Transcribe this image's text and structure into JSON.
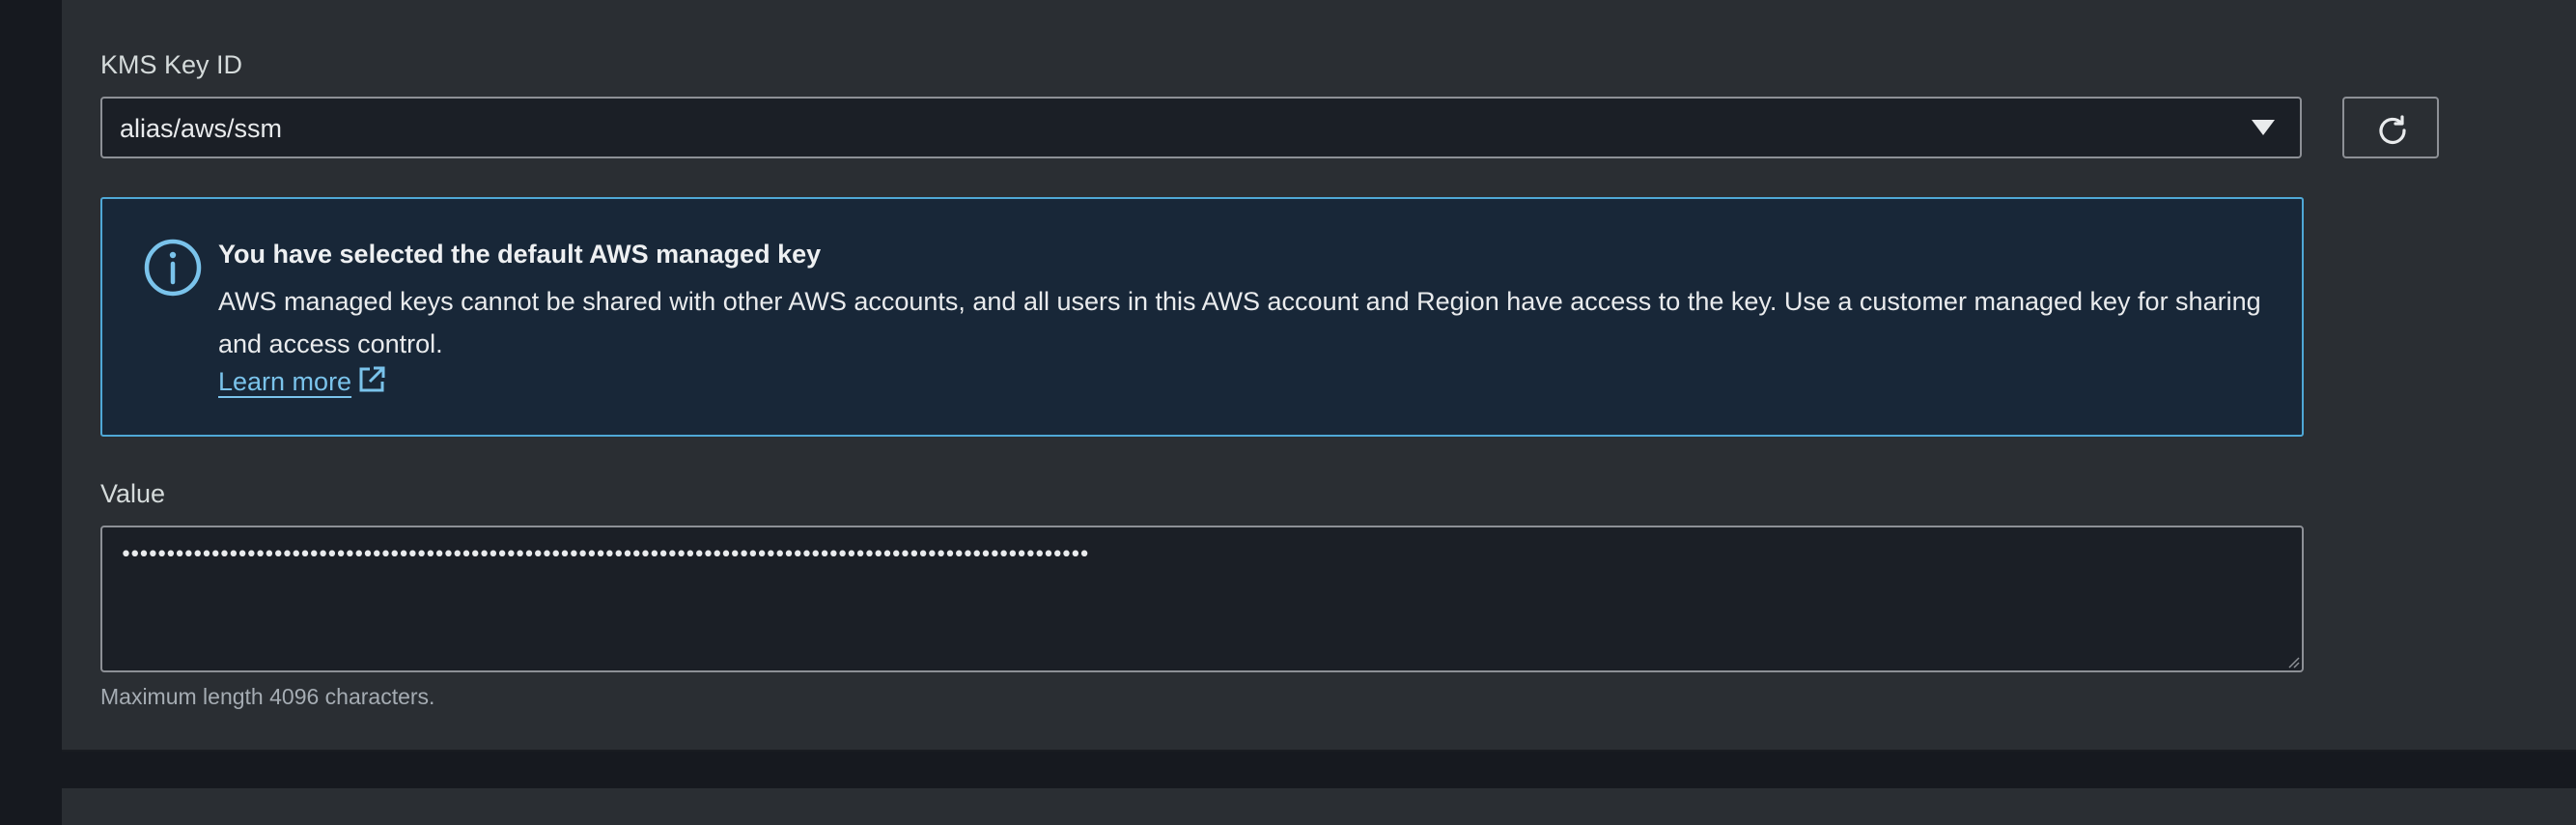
{
  "kms": {
    "label": "KMS Key ID",
    "selected_value": "alias/aws/ssm",
    "refresh_icon": "refresh-icon"
  },
  "info": {
    "icon": "info-icon",
    "title": "You have selected the default AWS managed key",
    "body": "AWS managed keys cannot be shared with other AWS accounts, and all users in this AWS account and Region have access to the key. Use a customer managed key for sharing and access control.",
    "link_label": "Learn more",
    "link_icon": "external-link-icon"
  },
  "value_field": {
    "label": "Value",
    "masked_value": "••••••••••••••••••••••••••••••••••••••••••••••••••••••••••••••••••••••••••••••••••••••••••••••••••••••••••••",
    "hint": "Maximum length 4096 characters."
  },
  "colors": {
    "background": "#16191f",
    "panel": "#2a2e33",
    "input_bg": "#1b1f26",
    "info_bg": "#182738",
    "info_border": "#4fa8d6",
    "link": "#7ac3eb"
  }
}
